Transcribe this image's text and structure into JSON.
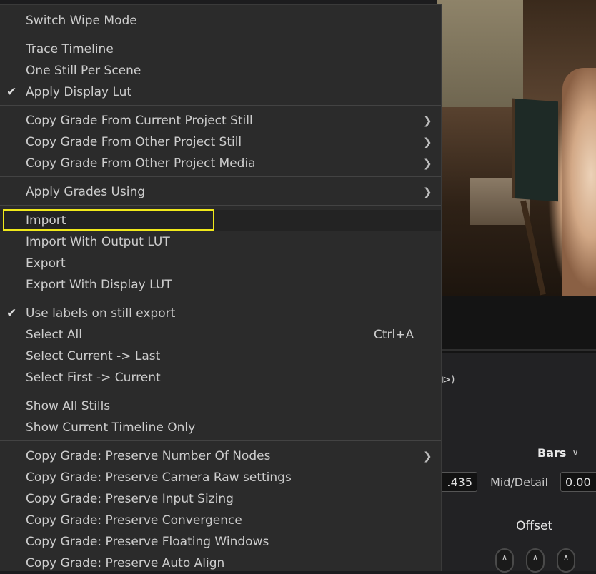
{
  "menu": {
    "sections": [
      [
        {
          "label": "Switch Wipe Mode"
        }
      ],
      [
        {
          "label": "Trace Timeline"
        },
        {
          "label": "One Still Per Scene"
        },
        {
          "label": "Apply Display Lut",
          "checked": true
        }
      ],
      [
        {
          "label": "Copy Grade From Current Project Still",
          "submenu": true
        },
        {
          "label": "Copy Grade From Other Project Still",
          "submenu": true
        },
        {
          "label": "Copy Grade From Other Project Media",
          "submenu": true
        }
      ],
      [
        {
          "label": "Apply Grades Using",
          "submenu": true
        }
      ],
      [
        {
          "label": "Import",
          "highlighted": true
        },
        {
          "label": "Import With Output LUT"
        },
        {
          "label": "Export"
        },
        {
          "label": "Export With Display LUT"
        }
      ],
      [
        {
          "label": "Use labels on still export",
          "checked": true
        },
        {
          "label": "Select All",
          "shortcut": "Ctrl+A"
        },
        {
          "label": "Select Current -> Last"
        },
        {
          "label": "Select First -> Current"
        }
      ],
      [
        {
          "label": "Show All Stills"
        },
        {
          "label": "Show Current Timeline Only"
        }
      ],
      [
        {
          "label": "Copy Grade: Preserve Number Of Nodes",
          "submenu": true
        },
        {
          "label": "Copy Grade: Preserve Camera Raw settings"
        },
        {
          "label": "Copy Grade: Preserve Input Sizing"
        },
        {
          "label": "Copy Grade: Preserve Convergence"
        },
        {
          "label": "Copy Grade: Preserve Floating Windows"
        },
        {
          "label": "Copy Grade: Preserve Auto Align"
        }
      ]
    ]
  },
  "icons": {
    "check": "check-icon",
    "submenu": "chevron-right-icon"
  },
  "highlight_color": "#f0e81a",
  "background": {
    "scope_mode": "Bars",
    "value_left": ".435",
    "mid_detail_label": "Mid/Detail",
    "mid_detail_value": "0.00",
    "offset_label": "Offset"
  }
}
